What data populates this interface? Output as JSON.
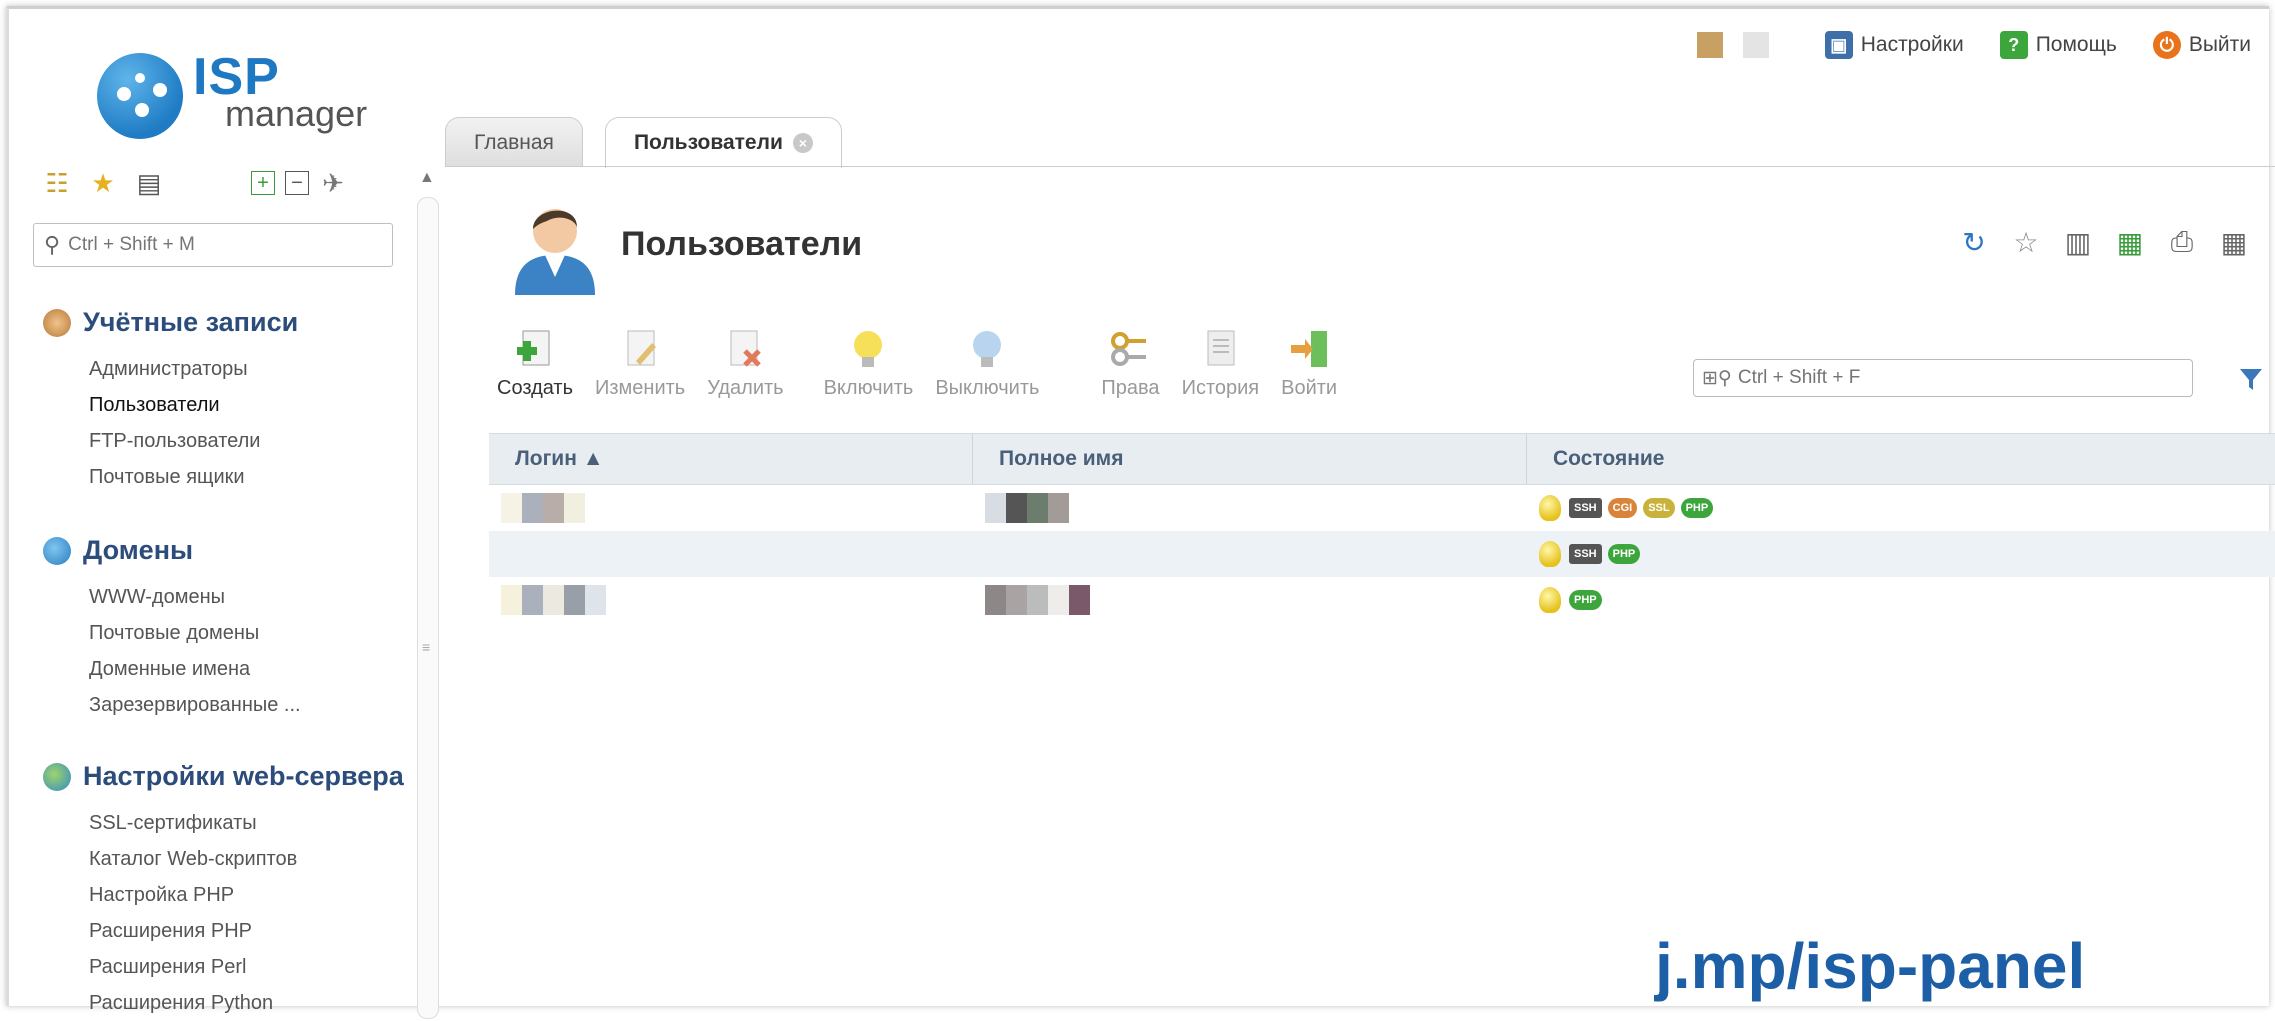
{
  "logo": {
    "text_isp": "ISP",
    "text_manager": "manager"
  },
  "top_menu": {
    "settings": "Настройки",
    "help": "Помощь",
    "logout": "Выйти"
  },
  "sidebar": {
    "search_placeholder": "Ctrl + Shift + M",
    "sections": [
      {
        "title": "Учётные записи",
        "items": [
          "Администраторы",
          "Пользователи",
          "FTP-пользователи",
          "Почтовые ящики"
        ]
      },
      {
        "title": "Домены",
        "items": [
          "WWW-домены",
          "Почтовые домены",
          "Доменные имена",
          "Зарезервированные ..."
        ]
      },
      {
        "title": "Настройки web-сервера",
        "items": [
          "SSL-сертификаты",
          "Каталог Web-скриптов",
          "Настройка PHP",
          "Расширения PHP",
          "Расширения Perl",
          "Расширения Python"
        ]
      }
    ]
  },
  "tabs": [
    {
      "label": "Главная"
    },
    {
      "label": "Пользователи"
    }
  ],
  "page": {
    "title": "Пользователи"
  },
  "toolbar": {
    "create": "Создать",
    "edit": "Изменить",
    "delete": "Удалить",
    "enable": "Включить",
    "disable": "Выключить",
    "rights": "Права",
    "history": "История",
    "login": "Войти"
  },
  "grid": {
    "search_placeholder": "Ctrl + Shift + F",
    "columns": [
      "Логин ▲",
      "Полное имя",
      "Состояние"
    ],
    "rows": [
      {
        "badges": [
          "SSH",
          "CGI",
          "SSL",
          "PHP"
        ]
      },
      {
        "badges": [
          "SSH",
          "PHP"
        ]
      },
      {
        "badges": [
          "PHP"
        ]
      }
    ]
  },
  "watermark": "j.mp/isp-panel",
  "colors": {
    "brand_blue": "#1e78c2",
    "section_title": "#2c4c7c",
    "header_bg": "#e8edf2"
  }
}
